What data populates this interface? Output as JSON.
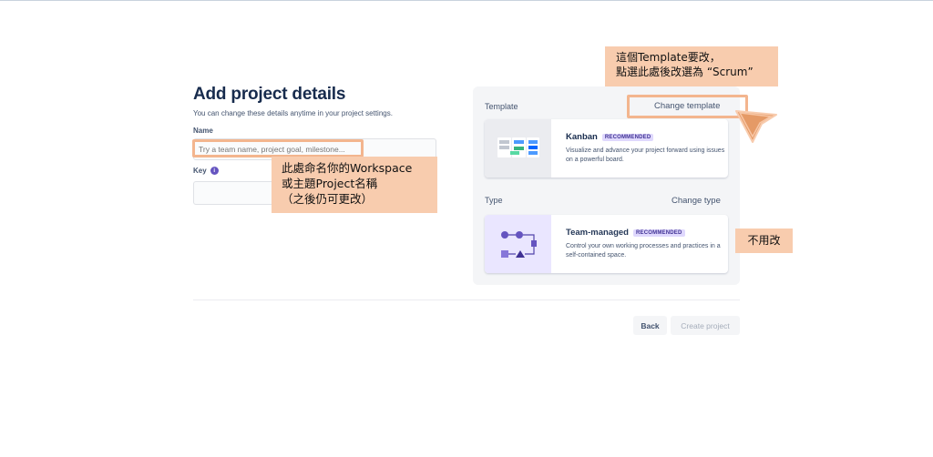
{
  "page": {
    "title": "Add project details",
    "subtitle": "You can change these details anytime in your project settings."
  },
  "form": {
    "name_label": "Name",
    "name_placeholder": "Try a team name, project goal, milestone...",
    "key_label": "Key",
    "key_value": "",
    "info_icon": "i"
  },
  "template": {
    "section_label": "Template",
    "change_label": "Change template",
    "card": {
      "title": "Kanban",
      "badge": "RECOMMENDED",
      "description": "Visualize and advance your project forward using issues on a powerful board."
    }
  },
  "type": {
    "section_label": "Type",
    "change_label": "Change type",
    "card": {
      "title": "Team-managed",
      "badge": "RECOMMENDED",
      "description": "Control your own working processes and practices in a self-contained space."
    }
  },
  "footer": {
    "back_label": "Back",
    "create_label": "Create project"
  },
  "annotations": {
    "top_line1": "這個Template要改，",
    "top_line2": "點選此處後改選為 “Scrum”",
    "left_line1": "此處命名你的Workspace",
    "left_line2": "或主題Project名稱",
    "left_line3": "（之後仍可更改）",
    "right": "不用改"
  },
  "colors": {
    "title": "#172b4d",
    "badge_bg": "#dfd8fd",
    "badge_text": "#403294",
    "annotation_bg": "#f8ccae",
    "annotation_outline": "#f3b58e",
    "arrow": "#e59a66"
  },
  "icons": {
    "info": "info-icon",
    "kanban_thumbnail": "kanban-board-illustration",
    "team_thumbnail": "workflow-illustration",
    "arrow": "arrow-cursor-icon"
  }
}
